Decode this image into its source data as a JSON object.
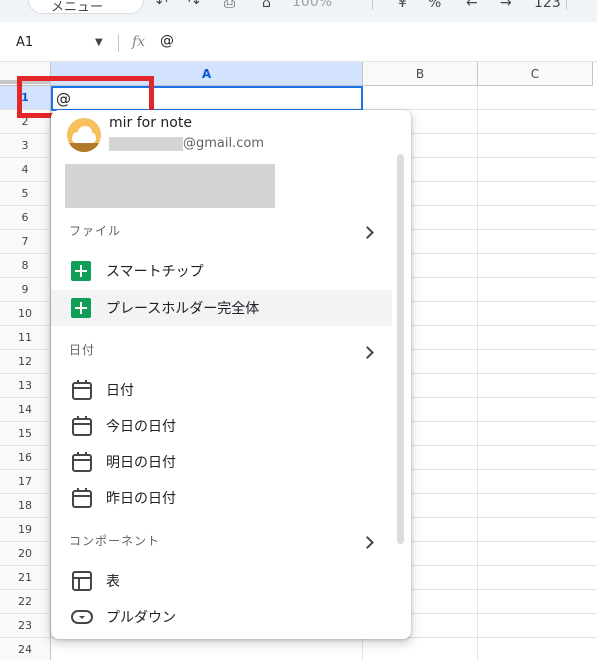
{
  "toolbar": {
    "menu_label": "メニュー",
    "zoom": "100%"
  },
  "formula_bar": {
    "name_box": "A1",
    "fx_label": "fx",
    "value": "@"
  },
  "grid": {
    "columns": [
      "A",
      "B",
      "C"
    ],
    "rows": [
      "1",
      "2",
      "3",
      "4",
      "5",
      "6",
      "7",
      "8",
      "9",
      "10",
      "11",
      "12",
      "13",
      "14",
      "15",
      "16",
      "17",
      "18",
      "19",
      "20",
      "21",
      "22",
      "23",
      "24"
    ],
    "active_cell_value": "@"
  },
  "dropdown": {
    "user": {
      "name": "mir for note",
      "email_suffix": "@gmail.com"
    },
    "sections": [
      {
        "label": "ファイル",
        "items": [
          {
            "label": "スマートチップ",
            "icon": "sheets-icon"
          },
          {
            "label": "プレースホルダー完全体",
            "icon": "sheets-icon"
          }
        ]
      },
      {
        "label": "日付",
        "items": [
          {
            "label": "日付",
            "icon": "calendar-icon"
          },
          {
            "label": "今日の日付",
            "icon": "calendar-icon"
          },
          {
            "label": "明日の日付",
            "icon": "calendar-icon"
          },
          {
            "label": "昨日の日付",
            "icon": "calendar-icon"
          }
        ]
      },
      {
        "label": "コンポーネント",
        "items": [
          {
            "label": "表",
            "icon": "table-icon"
          },
          {
            "label": "プルダウン",
            "icon": "dropdown-chip-icon"
          }
        ]
      }
    ]
  },
  "colors": {
    "selection_blue": "#1a73e8",
    "highlight_red": "#e3262a",
    "sheets_green": "#0f9d58"
  }
}
